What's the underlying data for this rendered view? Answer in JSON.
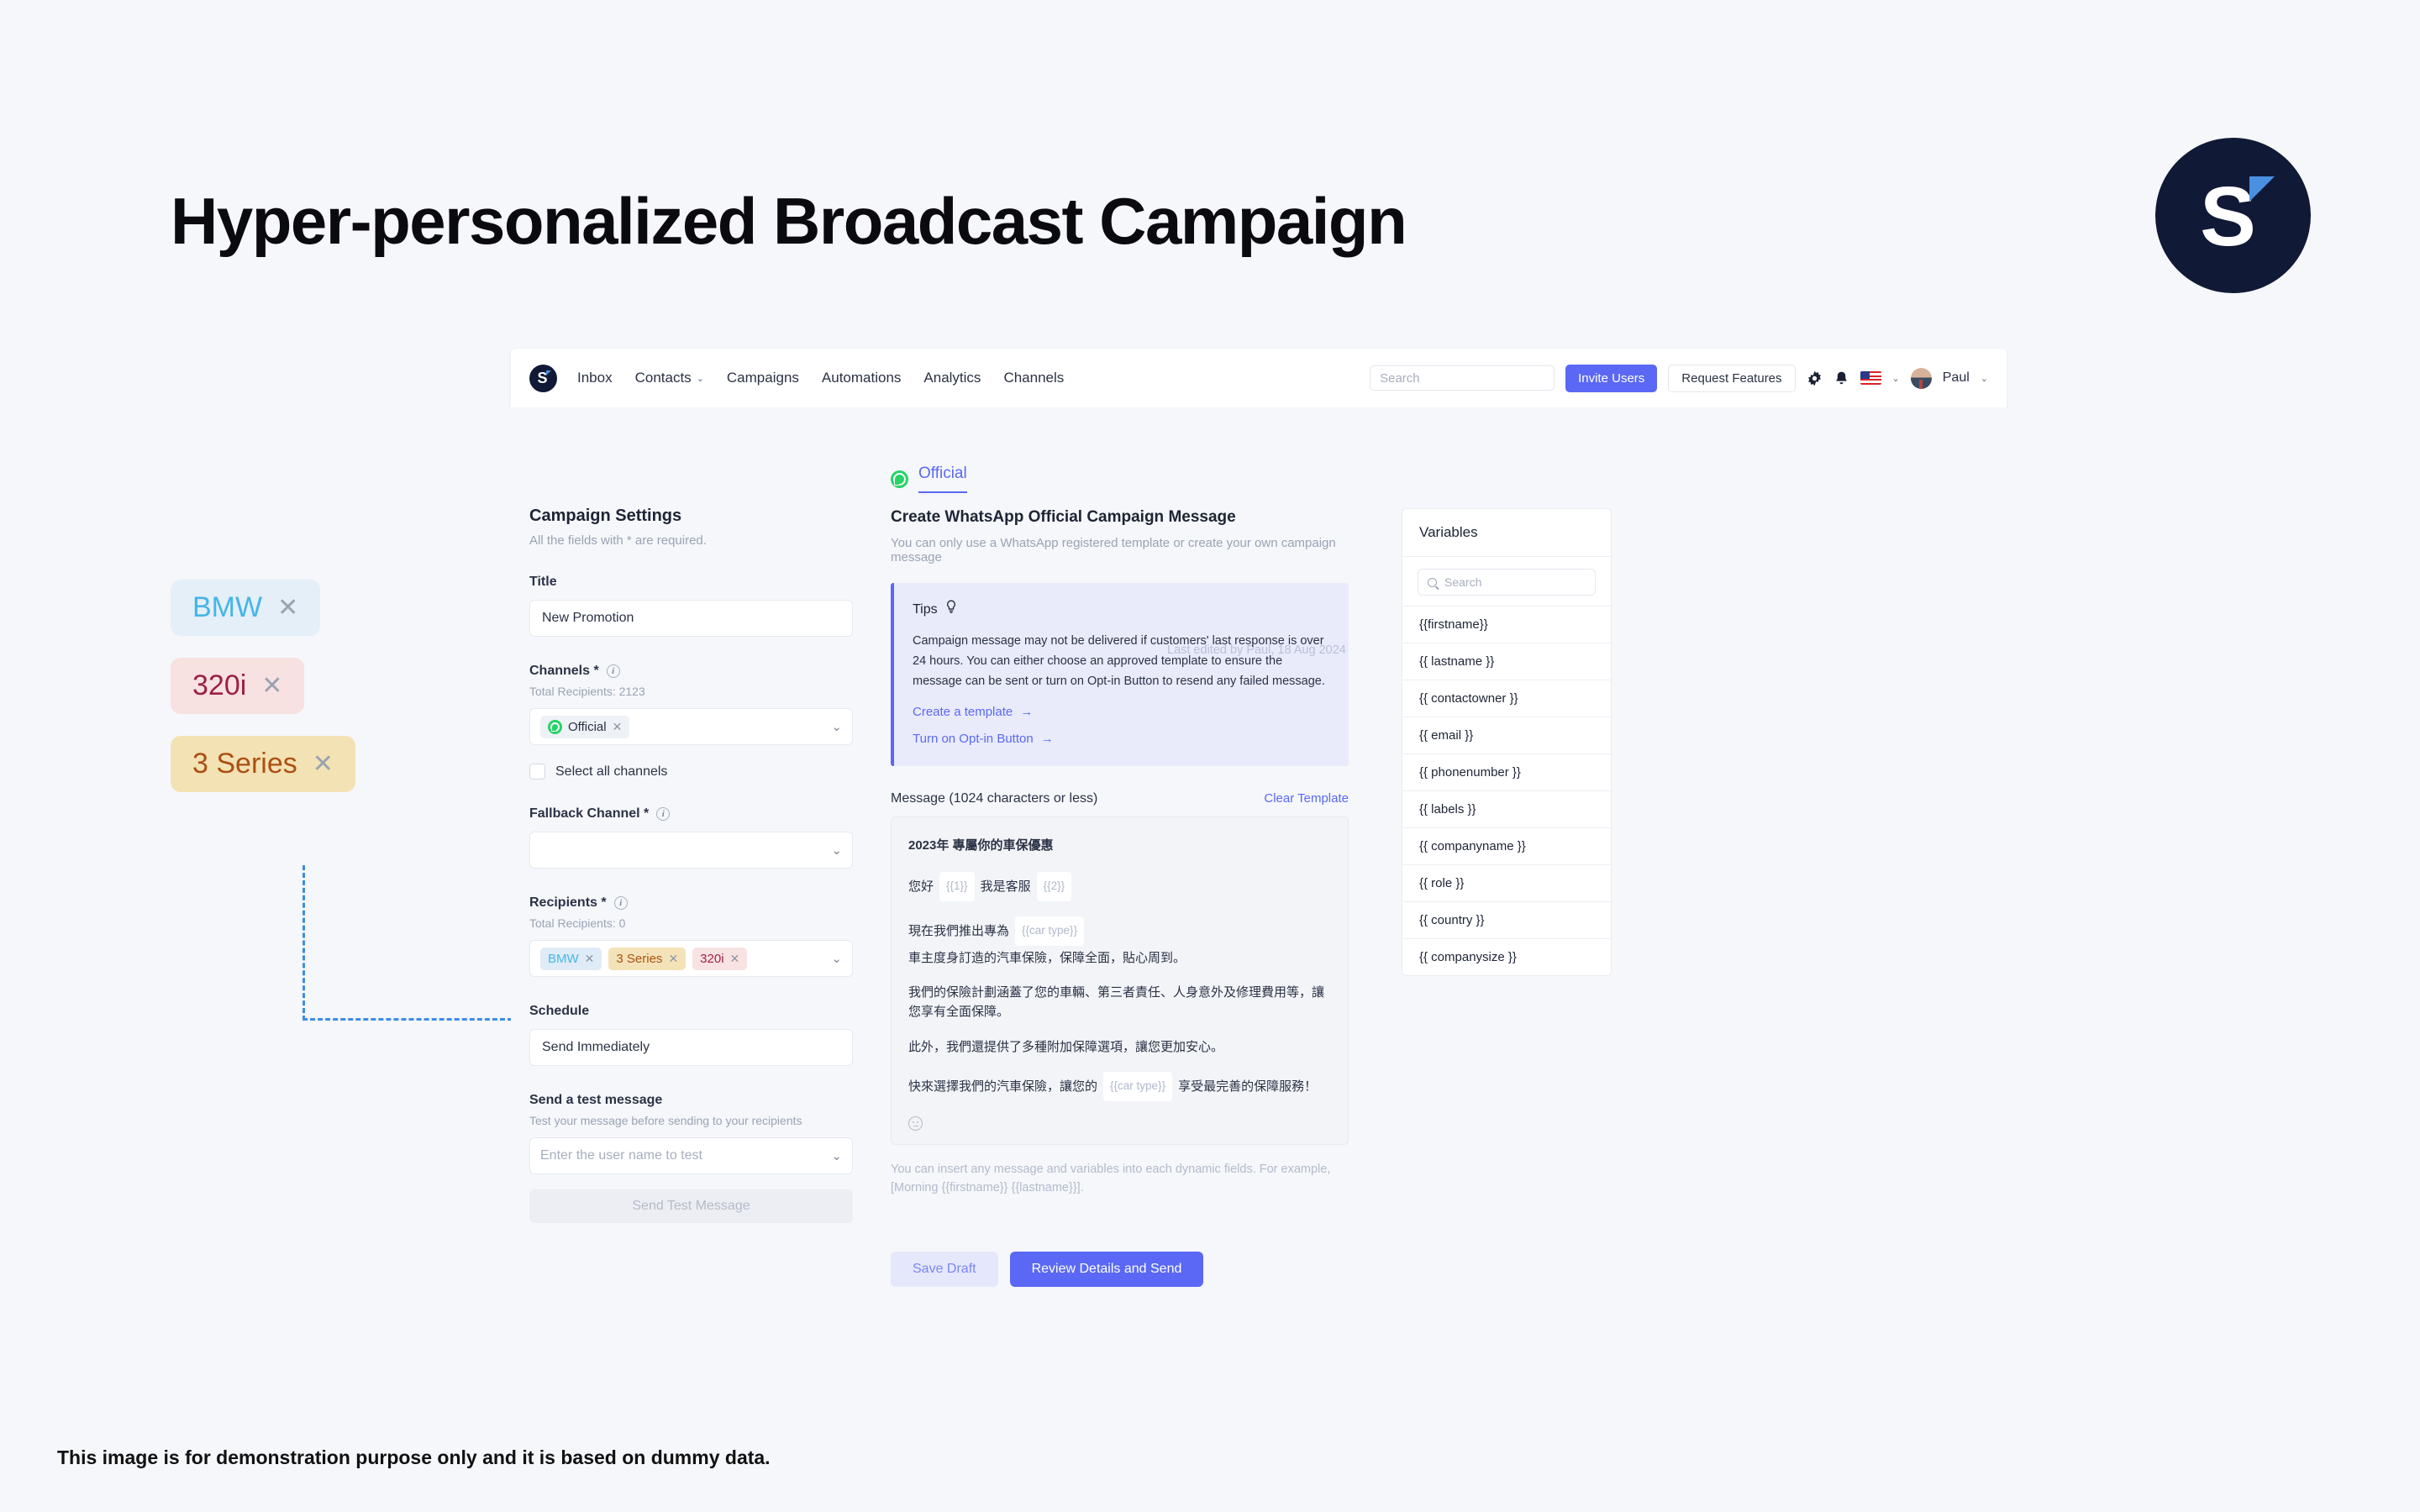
{
  "headline": "Hyper-personalized Broadcast Campaign",
  "brand": {
    "letter": "S"
  },
  "footer": "This image is for demonstration purpose only and it is based on dummy data.",
  "floating_tags": [
    {
      "label": "BMW",
      "close": "✕"
    },
    {
      "label": "320i",
      "close": "✕"
    },
    {
      "label": "3 Series",
      "close": "✕"
    }
  ],
  "navbar": {
    "logo_letter": "S",
    "links": [
      {
        "label": "Inbox",
        "has_caret": false
      },
      {
        "label": "Contacts",
        "has_caret": true
      },
      {
        "label": "Campaigns",
        "has_caret": false
      },
      {
        "label": "Automations",
        "has_caret": false
      },
      {
        "label": "Analytics",
        "has_caret": false
      },
      {
        "label": "Channels",
        "has_caret": false
      }
    ],
    "search_placeholder": "Search",
    "invite_label": "Invite Users",
    "request_label": "Request Features",
    "user_name": "Paul",
    "caret": "⌄"
  },
  "tab": {
    "label": "Official"
  },
  "settings": {
    "title": "Campaign Settings",
    "subtitle": "All the fields with * are required.",
    "title_field": {
      "label": "Title",
      "value": "New Promotion"
    },
    "channels": {
      "label": "Channels *",
      "total": "Total Recipients: 2123",
      "chip": "Official",
      "chip_close": "✕",
      "caret": "⌄"
    },
    "select_all": "Select all channels",
    "fallback": {
      "label": "Fallback Channel *",
      "value": "",
      "caret": "⌄"
    },
    "recipients": {
      "label": "Recipients *",
      "total": "Total Recipients: 0",
      "caret": "⌄",
      "chips": [
        {
          "label": "BMW",
          "close": "✕"
        },
        {
          "label": "3 Series",
          "close": "✕"
        },
        {
          "label": "320i",
          "close": "✕"
        }
      ]
    },
    "schedule": {
      "label": "Schedule",
      "value": "Send Immediately"
    },
    "test": {
      "label": "Send a test message",
      "sub": "Test your message before sending to your recipients",
      "placeholder": "Enter the user name to test",
      "caret": "⌄",
      "button": "Send Test Message"
    }
  },
  "center": {
    "title": "Create WhatsApp Official Campaign Message",
    "subtitle": "You can only use a WhatsApp registered template or create your own campaign message",
    "tips": {
      "heading": "Tips",
      "bulb": "Ὂ1",
      "body": "Campaign message may not be delivered if customers' last response is over 24 hours. You can either choose an approved template to ensure the message can be sent or turn on Opt-in Button to resend any failed message.",
      "ghost_overlap": "Last edited by Paul, 18 Aug 2024",
      "links": [
        {
          "label": "Create a template",
          "arrow": "→"
        },
        {
          "label": "Turn on Opt-in Button",
          "arrow": "→"
        }
      ]
    },
    "message": {
      "label": "Message (1024 characters or less)",
      "clear": "Clear Template",
      "lines": [
        {
          "type": "bold",
          "parts": [
            {
              "t": "text",
              "v": "2023年 專屬你的車保優惠"
            }
          ]
        },
        {
          "type": "normal",
          "parts": [
            {
              "t": "text",
              "v": "您好"
            },
            {
              "t": "var",
              "v": "{{1}}"
            },
            {
              "t": "text",
              "v": "我是客服"
            },
            {
              "t": "var",
              "v": "{{2}}"
            }
          ]
        },
        {
          "type": "normal",
          "parts": [
            {
              "t": "text",
              "v": "現在我們推出專為"
            },
            {
              "t": "var",
              "v": "{{car type}}"
            },
            {
              "t": "text",
              "v": "車主度身訂造的汽車保險，保障全面，貼心周到。"
            }
          ]
        },
        {
          "type": "normal",
          "parts": [
            {
              "t": "text",
              "v": "我們的保險計劃涵蓋了您的車輛、第三者責任、人身意外及修理費用等，讓您享有全面保障。"
            }
          ]
        },
        {
          "type": "normal",
          "parts": [
            {
              "t": "text",
              "v": "此外，我們還提供了多種附加保障選項，讓您更加安心。"
            }
          ]
        },
        {
          "type": "normal",
          "parts": [
            {
              "t": "text",
              "v": "快來選擇我們的汽車保險，讓您的"
            },
            {
              "t": "var",
              "v": "{{car type}}"
            },
            {
              "t": "text",
              "v": "享受最完善的保障服務！"
            }
          ]
        }
      ]
    },
    "hint": "You can insert any message and variables into each dynamic fields. For example, [Morning {{firstname}} {{lastname}}].",
    "save_draft": "Save Draft",
    "review_send": "Review Details and Send"
  },
  "variables": {
    "title": "Variables",
    "search_placeholder": "Search",
    "items": [
      "{{firstname}}",
      "{{ lastname }}",
      "{{ contactowner }}",
      "{{ email }}",
      "{{ phonenumber }}",
      "{{ labels }}",
      "{{ companyname }}",
      "{{ role }}",
      "{{ country }}",
      "{{ companysize }}"
    ]
  }
}
